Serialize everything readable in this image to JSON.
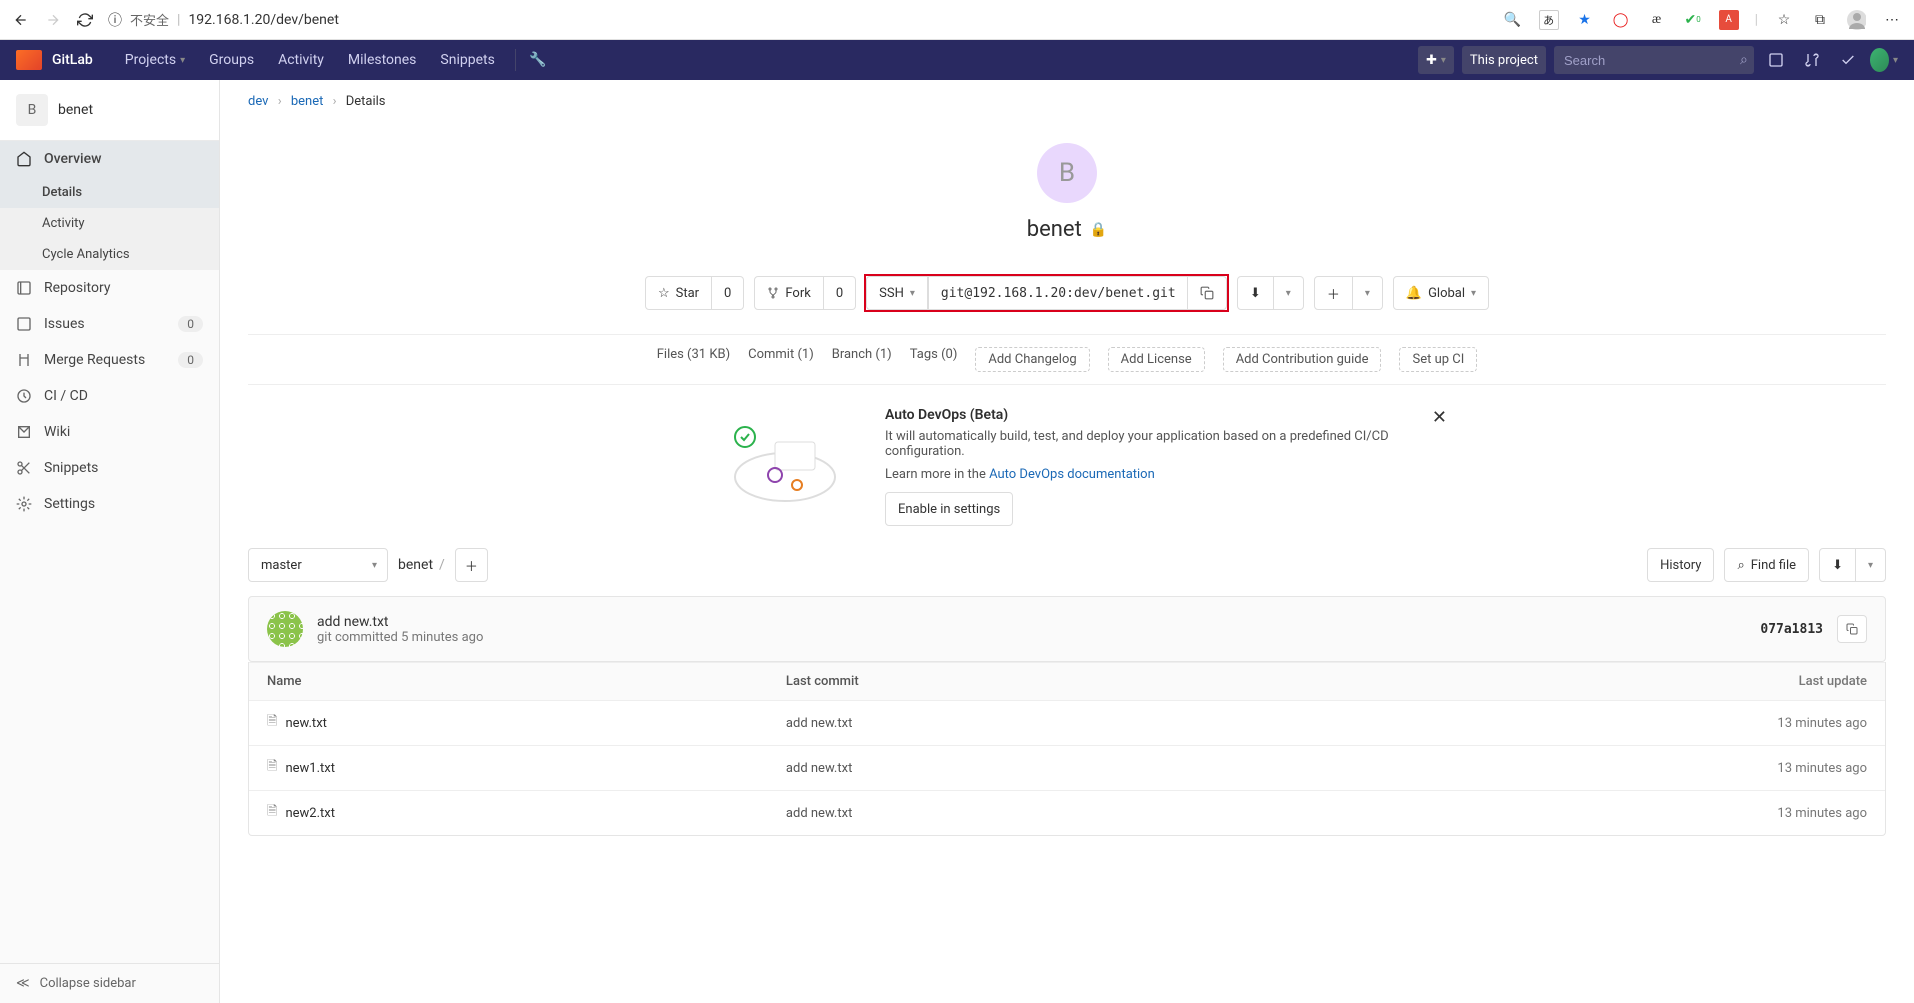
{
  "browser": {
    "insecure_label": "不安全",
    "url": "192.168.1.20/dev/benet"
  },
  "gitlab": {
    "brand": "GitLab",
    "nav": {
      "projects": "Projects",
      "groups": "Groups",
      "activity": "Activity",
      "milestones": "Milestones",
      "snippets": "Snippets"
    },
    "search_scope": "This project",
    "search_placeholder": "Search"
  },
  "sidebar": {
    "project_initial": "B",
    "project_name": "benet",
    "overview": "Overview",
    "details": "Details",
    "activity": "Activity",
    "cycle_analytics": "Cycle Analytics",
    "repository": "Repository",
    "issues": "Issues",
    "issues_count": "0",
    "merge_requests": "Merge Requests",
    "mr_count": "0",
    "cicd": "CI / CD",
    "wiki": "Wiki",
    "snippets": "Snippets",
    "settings": "Settings",
    "collapse": "Collapse sidebar"
  },
  "breadcrumb": {
    "group": "dev",
    "project": "benet",
    "page": "Details"
  },
  "hero": {
    "initial": "B",
    "name": "benet"
  },
  "actions": {
    "star": "Star",
    "star_count": "0",
    "fork": "Fork",
    "fork_count": "0",
    "protocol": "SSH",
    "clone_url": "git@192.168.1.20:dev/benet.git",
    "global": "Global"
  },
  "stats": {
    "files": "Files (31 KB)",
    "commit": "Commit (1)",
    "branch": "Branch (1)",
    "tags": "Tags (0)",
    "add_changelog": "Add Changelog",
    "add_license": "Add License",
    "add_contrib": "Add Contribution guide",
    "setup_ci": "Set up CI"
  },
  "autodevops": {
    "title": "Auto DevOps (Beta)",
    "desc": "It will automatically build, test, and deploy your application based on a predefined CI/CD configuration.",
    "learn_prefix": "Learn more in the ",
    "learn_link": "Auto DevOps documentation",
    "enable": "Enable in settings"
  },
  "file_bar": {
    "branch": "master",
    "path_root": "benet",
    "history": "History",
    "find_file": "Find file"
  },
  "last_commit": {
    "message": "add new.txt",
    "meta": "git committed 5 minutes ago",
    "sha": "077a1813"
  },
  "file_table": {
    "headers": {
      "name": "Name",
      "commit": "Last commit",
      "update": "Last update"
    },
    "rows": [
      {
        "name": "new.txt",
        "commit": "add new.txt",
        "update": "13 minutes ago"
      },
      {
        "name": "new1.txt",
        "commit": "add new.txt",
        "update": "13 minutes ago"
      },
      {
        "name": "new2.txt",
        "commit": "add new.txt",
        "update": "13 minutes ago"
      }
    ]
  }
}
